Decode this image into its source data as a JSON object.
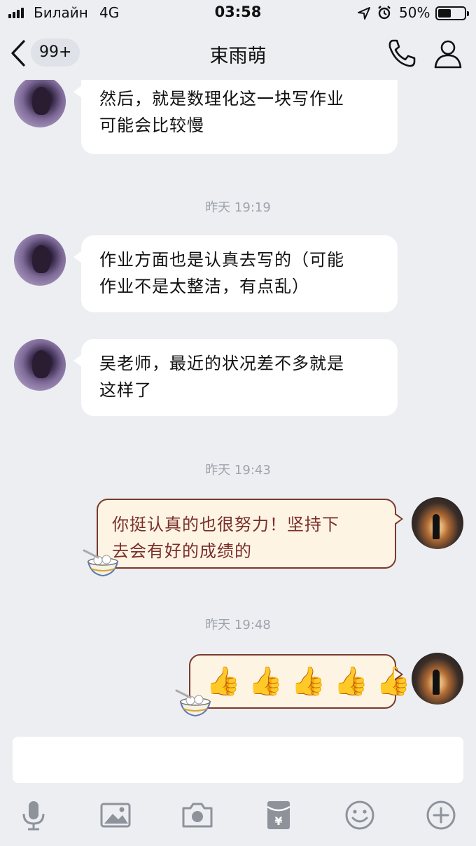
{
  "status_bar": {
    "carrier": "Билайн",
    "network": "4G",
    "time": "03:58",
    "battery": "50%",
    "battery_level": 0.5
  },
  "nav": {
    "unread_badge": "99+",
    "title": "束雨萌",
    "back_icon": "chevron-left-icon",
    "call_icon": "phone-icon",
    "profile_icon": "user-icon"
  },
  "messages": [
    {
      "type": "received",
      "lines": [
        "然后，就是数理化这一块写作业",
        "可能会比较慢"
      ]
    },
    {
      "type": "timestamp",
      "text": "昨天 19:19"
    },
    {
      "type": "received",
      "lines": [
        "作业方面也是认真去写的（可能",
        "作业不是太整洁，有点乱）"
      ]
    },
    {
      "type": "received",
      "lines": [
        "吴老师，最近的状况差不多就是",
        "这样了"
      ]
    },
    {
      "type": "timestamp",
      "text": "昨天 19:43"
    },
    {
      "type": "sent",
      "lines": [
        "你挺认真的也很努力！坚持下",
        "去会有好的成绩的"
      ]
    },
    {
      "type": "timestamp",
      "text": "昨天 19:48"
    },
    {
      "type": "sent",
      "emoji": [
        "👍",
        "👍",
        "👍",
        "👍",
        "👍"
      ]
    }
  ],
  "toolbar": [
    "microphone-icon",
    "image-icon",
    "camera-icon",
    "red-packet-icon",
    "emoji-icon",
    "plus-icon"
  ],
  "colors": {
    "background": "#eceef2",
    "sent_bubble": "#fdf4e4",
    "sent_border": "#7a3a2b",
    "sent_text": "#7a2e28",
    "timestamp": "#9ea3ab"
  }
}
